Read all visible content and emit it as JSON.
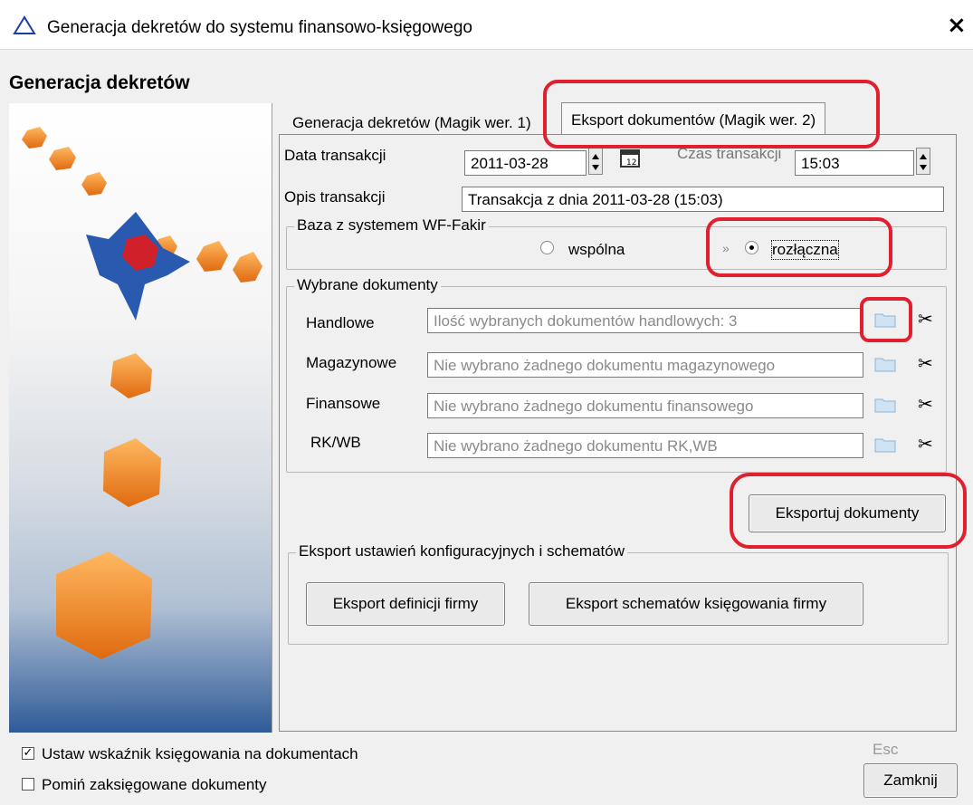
{
  "window": {
    "title": "Generacja dekretów do systemu finansowo-księgowego",
    "close_glyph": "×"
  },
  "header": {
    "title": "Generacja dekretów"
  },
  "tabs": [
    {
      "label": "Generacja dekretów (Magik wer. 1)"
    },
    {
      "label": "Eksport dokumentów (Magik wer. 2)"
    }
  ],
  "transaction": {
    "date_label": "Data transakcji",
    "date_value": "2011-03-28",
    "time_label": "Czas transakcji",
    "time_value": "15:03",
    "desc_label": "Opis transakcji",
    "desc_value": "Transakcja z dnia 2011-03-28 (15:03)"
  },
  "database": {
    "group_title": "Baza z systemem WF-Fakir",
    "option_shared": "wspólna",
    "option_separate": "rozłączna",
    "arrow": "»",
    "selected": "rozłączna"
  },
  "documents": {
    "group_title": "Wybrane dokumenty",
    "rows": [
      {
        "label": "Handlowe",
        "value": "Ilość wybranych dokumentów handlowych: 3"
      },
      {
        "label": "Magazynowe",
        "value": "Nie wybrano żadnego dokumentu magazynowego"
      },
      {
        "label": "Finansowe",
        "value": "Nie wybrano żadnego dokumentu finansowego"
      },
      {
        "label": "RK/WB",
        "value": "Nie wybrano żadnego dokumentu RK,WB"
      }
    ]
  },
  "export_button": "Eksportuj dokumenty",
  "config": {
    "group_title": "Eksport ustawień konfiguracyjnych i schematów",
    "btn_company": "Eksport definicji firmy",
    "btn_schemes": "Eksport schematów księgowania firmy"
  },
  "footer": {
    "chk_marker_label": "Ustaw wskaźnik księgowania na dokumentach",
    "chk_marker_checked": true,
    "chk_skip_label": "Pomiń zaksięgowane dokumenty",
    "chk_skip_checked": false,
    "esc_hint": "Esc",
    "close_button": "Zamknij"
  },
  "icons": [
    "warning-triangle-icon",
    "calendar-icon",
    "folder-icon",
    "scissors-icon"
  ],
  "colors": {
    "highlight": "#e0202f",
    "accent_orange": "#f08a1c",
    "triangle_blue": "#1a3fa0"
  }
}
